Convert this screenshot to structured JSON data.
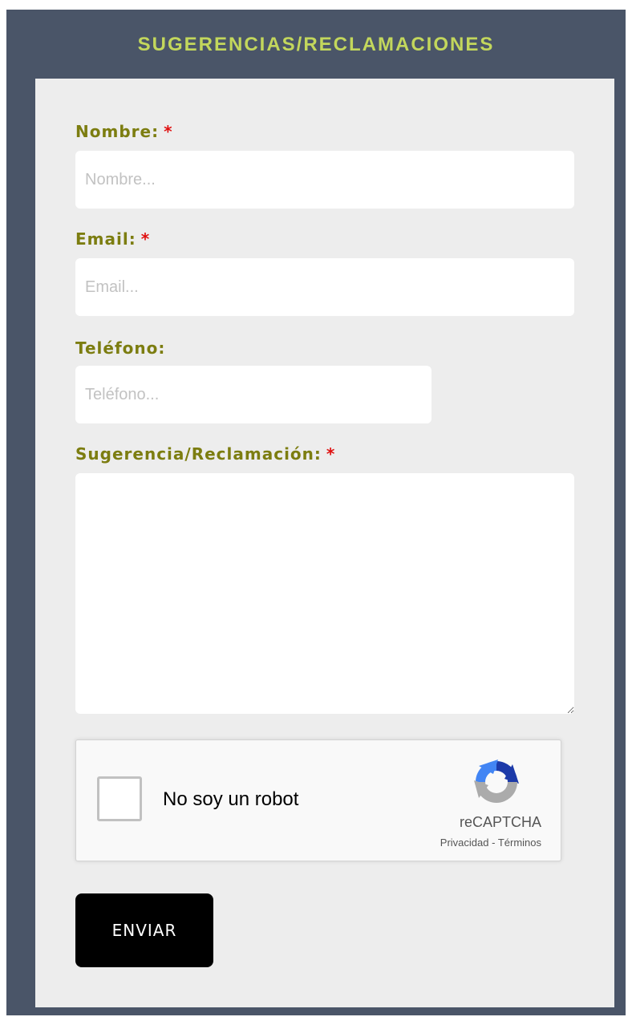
{
  "form": {
    "title": "SUGERENCIAS/RECLAMACIONES",
    "required_mark": "*",
    "fields": {
      "nombre": {
        "label": "Nombre:",
        "placeholder": "Nombre...",
        "required": true
      },
      "email": {
        "label": "Email:",
        "placeholder": "Email...",
        "required": true
      },
      "telefono": {
        "label": "Teléfono:",
        "placeholder": "Teléfono...",
        "required": false
      },
      "mensaje": {
        "label": "Sugerencia/Reclamación:",
        "placeholder": "",
        "required": true
      }
    },
    "captcha": {
      "checkbox_label": "No soy un robot",
      "brand": "reCAPTCHA",
      "privacy_link": "Privacidad",
      "separator": " - ",
      "terms_link": "Términos"
    },
    "submit_label": "ENVIAR"
  },
  "colors": {
    "frame_bg": "#4a5568",
    "title": "#c3d75c",
    "panel_bg": "#ededed",
    "label": "#7c7d10",
    "required": "#e01010",
    "button_bg": "#000000"
  }
}
